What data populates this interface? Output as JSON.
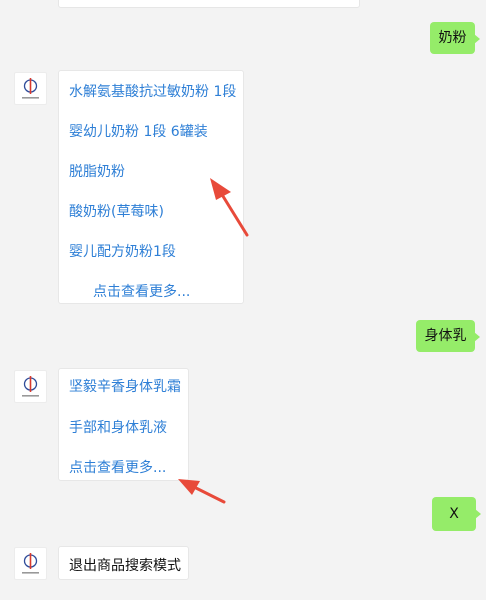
{
  "chat": {
    "msg1": {
      "text": "奶粉"
    },
    "reply1": {
      "items": [
        "水解氨基酸抗过敏奶粉 1段",
        "婴幼儿奶粉 1段 6罐装",
        "脱脂奶粉",
        "酸奶粉(草莓味)",
        "婴儿配方奶粉1段"
      ],
      "more": "点击查看更多..."
    },
    "msg2": {
      "text": "身体乳"
    },
    "reply2": {
      "items": [
        "坚毅辛香身体乳霜",
        "手部和身体乳液"
      ],
      "more": "点击查看更多..."
    },
    "msg3": {
      "text": "X"
    },
    "reply3": {
      "text": "退出商品搜索模式"
    }
  },
  "colors": {
    "link": "#2e7fd6",
    "bubble": "#95ec69",
    "annotation": "#e84a3a"
  },
  "icons": {
    "avatar": "brand-logo-icon",
    "annotation": "red-arrow-icon"
  }
}
